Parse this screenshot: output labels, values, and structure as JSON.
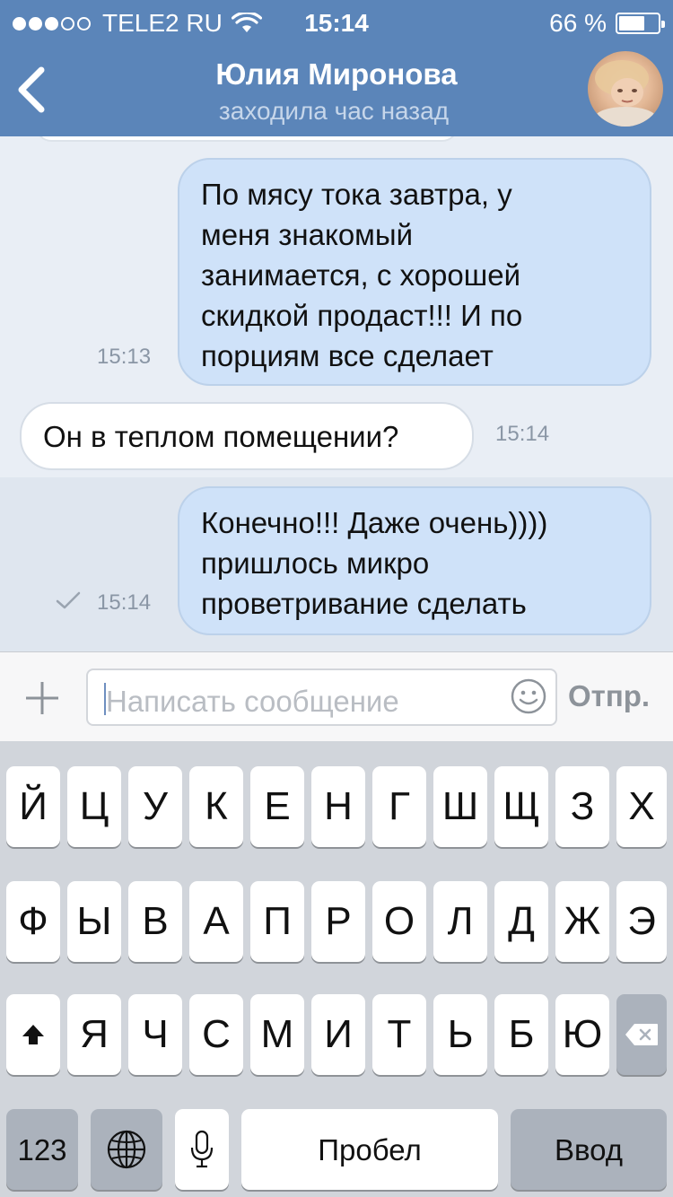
{
  "status_bar": {
    "carrier": "TELE2 RU",
    "time": "15:14",
    "battery_text": "66 %",
    "battery_level": 0.66,
    "signal_bars_filled": 3,
    "signal_bars_total": 5
  },
  "header": {
    "contact_name": "Юлия Миронова",
    "contact_status": "заходила час назад",
    "background_color": "#5b85b9"
  },
  "messages": [
    {
      "direction": "outgoing",
      "lines": [
        "По мясу тока завтра, у",
        "меня знакомый",
        "занимается, с хорошей",
        "скидкой продаст!!! И по",
        "порциям все сделает"
      ],
      "time": "15:13",
      "read_check": false
    },
    {
      "direction": "incoming",
      "lines": [
        "Он в теплом помещении?"
      ],
      "time": "15:14",
      "read_check": false
    },
    {
      "direction": "outgoing",
      "lines": [
        "Конечно!!! Даже очень))))",
        "пришлось микро",
        "проветривание сделать"
      ],
      "time": "15:14",
      "read_check": true
    }
  ],
  "composer": {
    "placeholder": "Написать сообщение",
    "send_label": "Отпр."
  },
  "keyboard": {
    "row1": [
      "Й",
      "Ц",
      "У",
      "К",
      "Е",
      "Н",
      "Г",
      "Ш",
      "Щ",
      "З",
      "Х"
    ],
    "row2": [
      "Ф",
      "Ы",
      "В",
      "А",
      "П",
      "Р",
      "О",
      "Л",
      "Д",
      "Ж",
      "Э"
    ],
    "row3": [
      "Я",
      "Ч",
      "С",
      "М",
      "И",
      "Т",
      "Ь",
      "Б",
      "Ю"
    ],
    "numbers_label": "123",
    "space_label": "Пробел",
    "return_label": "Ввод"
  },
  "colors": {
    "outgoing_bubble": "#cfe2f9",
    "incoming_bubble": "#ffffff",
    "keyboard_bg": "#d1d5db"
  }
}
